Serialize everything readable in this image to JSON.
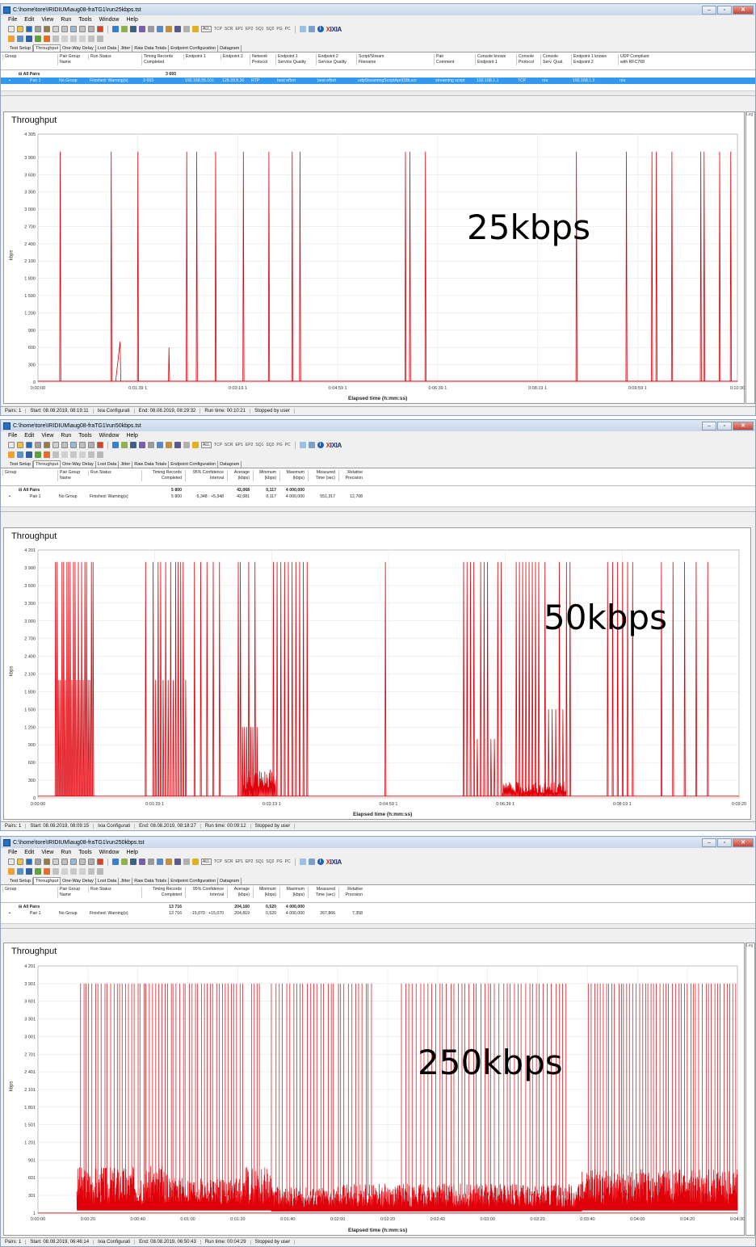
{
  "menu": [
    "File",
    "Edit",
    "View",
    "Run",
    "Tools",
    "Window",
    "Help"
  ],
  "toolbar": {
    "all_label": "ALL",
    "tags": [
      "TCP",
      "SCR",
      "EP1",
      "EP2",
      "SQ1",
      "SQ2",
      "PG",
      "PC"
    ],
    "brand_x": "X",
    "brand_rest": "IXIA"
  },
  "tabs": [
    "Test Setup",
    "Throughput",
    "One-Way Delay",
    "Lost Data",
    "Jitter",
    "Raw Data Totals",
    "Endpoint Configuration",
    "Datagram"
  ],
  "windows": [
    {
      "title": "C:\\home\\tore\\IRIDIUM\\aug08-fraTG1\\run25kbps.tst",
      "columns": [
        "Group",
        "Pair Group\nName",
        "Run Status",
        "Timing Records\nCompleted",
        "Endpoint 1",
        "Endpoint 2",
        "Network\nProtocol",
        "Endpoint 1\nService Quality",
        "Endpoint 2\nService Quality",
        "Script/Stream\nFilename",
        "Pair\nComment",
        "Console knows\nEndpoint 1",
        "Console\nProtocol",
        "Console\nServ. Qual.",
        "Endpoint 1 knows\nEndpoint 2",
        "UDP Compliant\nwith RFC768"
      ],
      "rows": [
        {
          "label": "All Pairs",
          "cells": [
            "3 693"
          ]
        },
        {
          "label": "Pair 1",
          "cells": [
            "No Group",
            "Finished: Warning(s)",
            "3 693",
            "192.168.55.101",
            "128.39.8.30",
            "RTP",
            "best effort",
            "best effort",
            "udpStreamingScriptApril18b.scr",
            "streaming script",
            "192.168.1.1",
            "TCP",
            "n/a",
            "192.168.1.2",
            "n/a"
          ]
        }
      ],
      "chart": {
        "title": "Throughput",
        "ylabel": "kbps",
        "xlabel": "Elapsed time (h:mm:ss)",
        "ymax_label": "4 305",
        "yticks": [
          "0",
          "300",
          "600",
          "900",
          "1 200",
          "1 500",
          "1 800",
          "2 100",
          "2 400",
          "2 700",
          "3 000",
          "3 300",
          "3 600",
          "3 900"
        ],
        "xticks": [
          "0:00:00",
          "0:01:39 1",
          "0:03:19 1",
          "0:04:59 1",
          "0:06:39 1",
          "0:08:19 1",
          "0:09:59 1",
          "0:10:30"
        ],
        "overlay": "25kbps",
        "legend": "Leg"
      },
      "status": [
        "Pairs: 1",
        "Start: 08.08.2019, 08:19:11",
        "Ixia Configurati",
        "End: 08.08.2019, 08:29:32",
        "Run time: 00:10:21",
        "Stopped by user"
      ]
    },
    {
      "title": "C:\\home\\tore\\IRIDIUM\\aug08-fraTG1\\run50kbps.tst",
      "columns": [
        "Group",
        "Pair Group\nName",
        "Run Status",
        "Timing Records\nCompleted",
        "95% Confidence\nInterval",
        "Average\n(kbps)",
        "Minimum\n(kbps)",
        "Maximum\n(kbps)",
        "Measured\nTime (sec)",
        "Relative\nPrecision"
      ],
      "rows": [
        {
          "label": "All Pairs",
          "cells": [
            "5 800",
            "",
            "42,068",
            "0,117",
            "4 000,000"
          ]
        },
        {
          "label": "Pair 1",
          "cells": [
            "No Group",
            "Finished: Warning(s)",
            "5 800",
            "-5,348 : +5,348",
            "42,081",
            "0,117",
            "4 000,000",
            "551,317",
            "12,708"
          ]
        }
      ],
      "chart": {
        "title": "Throughput",
        "ylabel": "kbps",
        "xlabel": "Elapsed time (h:mm:ss)",
        "ymax_label": "4 201",
        "yticks": [
          "0",
          "300",
          "600",
          "900",
          "1 200",
          "1 500",
          "1 800",
          "2 100",
          "2 400",
          "2 700",
          "3 000",
          "3 300",
          "3 600",
          "3 900"
        ],
        "xticks": [
          "0:00:00",
          "0:01:39 1",
          "0:03:19 1",
          "0:04:59 1",
          "0:06:39 1",
          "0:08:19 1",
          "0:09:20"
        ],
        "overlay": "50kbps",
        "legend": ""
      },
      "status": [
        "Pairs: 1",
        "Start: 08.08.2019, 08:09:15",
        "Ixia Configurati",
        "End: 08.08.2019, 08:18:27",
        "Run time: 00:09:12",
        "Stopped by user"
      ]
    },
    {
      "title": "C:\\home\\tore\\IRIDIUM\\aug08-fraTG1\\run250kbps.tst",
      "columns": [
        "Group",
        "Pair Group\nName",
        "Run Status",
        "Timing Records\nCompleted",
        "95% Confidence\nInterval",
        "Average\n(kbps)",
        "Minimum\n(kbps)",
        "Maximum\n(kbps)",
        "Measured\nTime (sec)",
        "Relative\nPrecision"
      ],
      "rows": [
        {
          "label": "All Pairs",
          "cells": [
            "13 716",
            "",
            "204,160",
            "0,520",
            "4 000,000"
          ]
        },
        {
          "label": "Pair 1",
          "cells": [
            "No Group",
            "Finished: Warning(s)",
            "13 716",
            "-15,070 : +15,070",
            "204,819",
            "0,520",
            "4 000,000",
            "267,866",
            "7,358"
          ]
        }
      ],
      "chart": {
        "title": "Throughput",
        "ylabel": "kbps",
        "xlabel": "Elapsed time (h:mm:ss)",
        "ymax_label": "4 201",
        "yticks": [
          "1",
          "301",
          "601",
          "901",
          "1 201",
          "1 501",
          "1 801",
          "2 101",
          "2 401",
          "2 701",
          "3 001",
          "3 301",
          "3 601",
          "3 901"
        ],
        "xticks": [
          "0:00:00",
          "0:00:20",
          "0:00:40",
          "0:01:00",
          "0:01:20",
          "0:01:40",
          "0:02:00",
          "0:02:20",
          "0:02:40",
          "0:03:00",
          "0:03:20",
          "0:03:40",
          "0:04:00",
          "0:04:20",
          "0:04:30"
        ],
        "overlay": "250kbps",
        "legend": "Leg"
      },
      "status": [
        "Pairs: 1",
        "Start: 08.08.2019, 06:46:14",
        "Ixia Configurati",
        "End: 08.08.2019, 06:50:43",
        "Run time: 00:04:29",
        "Stopped by user"
      ]
    }
  ],
  "chart_data": [
    {
      "type": "line",
      "title": "Throughput",
      "xlabel": "Elapsed time (h:mm:ss)",
      "ylabel": "kbps",
      "ylim": [
        0,
        4305
      ],
      "x_unit": "seconds",
      "xlim": [
        0,
        630
      ],
      "baseline_kbps": 15,
      "spikes": [
        {
          "x": 20,
          "y": 4000
        },
        {
          "x": 66,
          "y": 4000
        },
        {
          "x": 74,
          "y": 700,
          "ramp_from": 70
        },
        {
          "x": 90,
          "y": 4000
        },
        {
          "x": 118,
          "y": 600
        },
        {
          "x": 134,
          "y": 4000
        },
        {
          "x": 143,
          "y": 4000
        },
        {
          "x": 160,
          "y": 4000
        },
        {
          "x": 185,
          "y": 4000
        },
        {
          "x": 208,
          "y": 4000
        },
        {
          "x": 229,
          "y": 4000
        },
        {
          "x": 236,
          "y": 4000
        },
        {
          "x": 331,
          "y": 4000
        },
        {
          "x": 335,
          "y": 4000
        },
        {
          "x": 349,
          "y": 4000
        },
        {
          "x": 485,
          "y": 4000
        },
        {
          "x": 530,
          "y": 4000
        },
        {
          "x": 553,
          "y": 4000
        },
        {
          "x": 557,
          "y": 4000
        },
        {
          "x": 571,
          "y": 4000
        },
        {
          "x": 597,
          "y": 4000
        },
        {
          "x": 600,
          "y": 4000
        },
        {
          "x": 614,
          "y": 4000
        },
        {
          "x": 624,
          "y": 4000
        }
      ]
    },
    {
      "type": "line",
      "title": "Throughput",
      "xlabel": "Elapsed time (h:mm:ss)",
      "ylabel": "kbps",
      "ylim": [
        0,
        4201
      ],
      "x_unit": "seconds",
      "xlim": [
        0,
        560
      ],
      "baseline_kbps": 30,
      "bursts": [
        {
          "x_start": 14,
          "x_end": 44,
          "count": 24,
          "peak": 4000,
          "mid": 2000
        },
        {
          "x_start": 85,
          "x_end": 87,
          "count": 1,
          "peak": 4000,
          "mid": 0
        },
        {
          "x_start": 92,
          "x_end": 118,
          "count": 14,
          "peak": 4000,
          "mid": 2000
        },
        {
          "x_start": 125,
          "x_end": 145,
          "count": 5,
          "peak": 4000,
          "mid": 0
        },
        {
          "x_start": 160,
          "x_end": 175,
          "count": 10,
          "peak": 4000,
          "mid": 1200
        },
        {
          "x_start": 188,
          "x_end": 215,
          "count": 10,
          "peak": 4000,
          "mid": 0
        },
        {
          "x_start": 275,
          "x_end": 280,
          "count": 1,
          "peak": 4000,
          "mid": 0
        },
        {
          "x_start": 340,
          "x_end": 370,
          "count": 12,
          "peak": 4000,
          "mid": 1000
        },
        {
          "x_start": 382,
          "x_end": 400,
          "count": 8,
          "peak": 4000,
          "mid": 0
        },
        {
          "x_start": 405,
          "x_end": 425,
          "count": 8,
          "peak": 4000,
          "mid": 1500
        },
        {
          "x_start": 455,
          "x_end": 475,
          "count": 6,
          "peak": 4000,
          "mid": 0
        },
        {
          "x_start": 498,
          "x_end": 535,
          "count": 5,
          "peak": 4000,
          "mid": 0
        }
      ],
      "plateaus": [
        {
          "x_start": 163,
          "x_end": 190,
          "level": 450
        },
        {
          "x_start": 371,
          "x_end": 422,
          "level": 250
        }
      ]
    },
    {
      "type": "line",
      "title": "Throughput",
      "xlabel": "Elapsed time (h:mm:ss)",
      "ylabel": "kbps",
      "ylim": [
        0,
        4201
      ],
      "x_unit": "seconds",
      "xlim": [
        0,
        270
      ],
      "baseline_kbps": 1,
      "noise_band_start_s": 15,
      "noise_segments": [
        {
          "x_start": 15,
          "x_end": 50,
          "low": 150,
          "high": 800
        },
        {
          "x_start": 50,
          "x_end": 80,
          "low": 150,
          "high": 600
        },
        {
          "x_start": 80,
          "x_end": 90,
          "low": 150,
          "high": 800
        },
        {
          "x_start": 90,
          "x_end": 115,
          "low": 100,
          "high": 450
        },
        {
          "x_start": 115,
          "x_end": 210,
          "low": 100,
          "high": 500
        },
        {
          "x_start": 210,
          "x_end": 270,
          "low": 150,
          "high": 750
        }
      ],
      "spike_regions": [
        {
          "x_start": 16,
          "x_end": 80,
          "count": 55,
          "peak": 3901
        },
        {
          "x_start": 82,
          "x_end": 86,
          "count": 4,
          "peak": 3901
        },
        {
          "x_start": 90,
          "x_end": 130,
          "count": 30,
          "peak": 3901
        },
        {
          "x_start": 140,
          "x_end": 205,
          "count": 45,
          "peak": 3901
        },
        {
          "x_start": 212,
          "x_end": 270,
          "count": 50,
          "peak": 3901
        }
      ]
    }
  ],
  "colors": {
    "trace": "#e0000a",
    "grid": "#d8d8d8",
    "selection": "#3298f0"
  },
  "icons": [
    "new-file-icon",
    "open-folder-icon",
    "save-icon",
    "print-icon",
    "run-icon",
    "stop-icon",
    "info-icon"
  ]
}
